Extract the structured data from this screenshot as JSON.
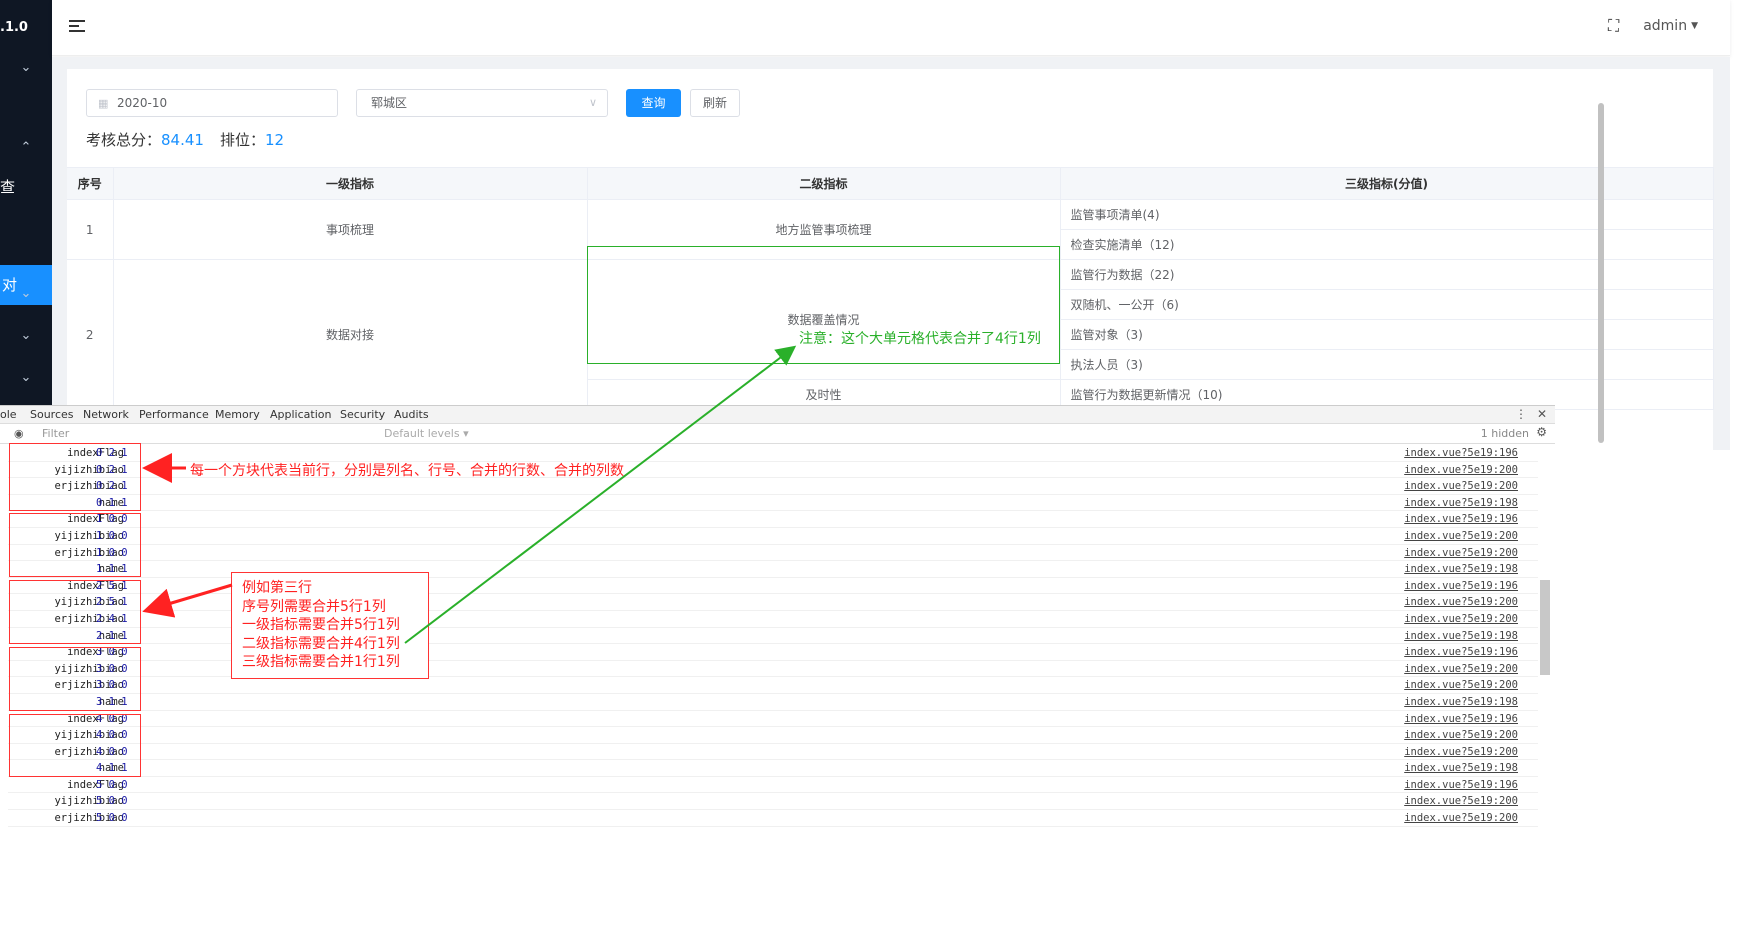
{
  "sidebar": {
    "version": ".1.0",
    "item_cha": "查",
    "item_active": "对"
  },
  "header": {
    "user": "admin"
  },
  "filters": {
    "date": "2020-10",
    "district": "郓城区",
    "query_label": "查询",
    "refresh_label": "刷新"
  },
  "score": {
    "total_label": "考核总分：",
    "total_value": "84.41",
    "rank_label": "排位：",
    "rank_value": "12"
  },
  "table": {
    "headers": [
      "序号",
      "一级指标",
      "二级指标",
      "三级指标(分值)"
    ],
    "row1": {
      "no": "1",
      "l1": "事项梳理",
      "l2": "地方监管事项梳理",
      "l3a": "监管事项清单(4)",
      "l3b": "检查实施清单（12)"
    },
    "row2": {
      "no": "2",
      "l1": "数据对接",
      "l2": "数据覆盖情况",
      "l3a": "监管行为数据（22)",
      "l3b": "双随机、一公开（6)",
      "l3c": "监管对象（3)",
      "l3d": "执法人员（3)",
      "l2b": "及时性",
      "l3e": "监管行为数据更新情况（10)"
    }
  },
  "annotations": {
    "green_note": "注意：这个大单元格代表合并了4行1列",
    "red_note": "每一个方块代表当前行，分别是列名、行号、合并的行数、合并的列数",
    "callout": [
      "例如第三行",
      "序号列需要合并5行1列",
      "一级指标需要合并5行1列",
      "二级指标需要合并4行1列",
      "三级指标需要合并1行1列"
    ]
  },
  "devtools": {
    "tabs": [
      "ole",
      "Sources",
      "Network",
      "Performance",
      "Memory",
      "Application",
      "Security",
      "Audits"
    ],
    "filter_placeholder": "Filter",
    "levels": "Default levels ▾",
    "hidden": "1 hidden"
  },
  "console_rows": [
    {
      "name": "indexFlag",
      "nums": "0 2 1",
      "src": "index.vue?5e19:196"
    },
    {
      "name": "yijizhibiao",
      "nums": "0 2 1",
      "src": "index.vue?5e19:200"
    },
    {
      "name": "erjizhibiao",
      "nums": "0 2 1",
      "src": "index.vue?5e19:200"
    },
    {
      "name": "name",
      "nums": "0 1 1",
      "src": "index.vue?5e19:198"
    },
    {
      "name": "indexFlag",
      "nums": "1 0 0",
      "src": "index.vue?5e19:196"
    },
    {
      "name": "yijizhibiao",
      "nums": "1 0 0",
      "src": "index.vue?5e19:200"
    },
    {
      "name": "erjizhibiao",
      "nums": "1 0 0",
      "src": "index.vue?5e19:200"
    },
    {
      "name": "name",
      "nums": "1 1 1",
      "src": "index.vue?5e19:198"
    },
    {
      "name": "indexFlag",
      "nums": "2 5 1",
      "src": "index.vue?5e19:196"
    },
    {
      "name": "yijizhibiao",
      "nums": "2 5 1",
      "src": "index.vue?5e19:200"
    },
    {
      "name": "erjizhibiao",
      "nums": "2 4 1",
      "src": "index.vue?5e19:200"
    },
    {
      "name": "name",
      "nums": "2 1 1",
      "src": "index.vue?5e19:198"
    },
    {
      "name": "indexFlag",
      "nums": "3 0 0",
      "src": "index.vue?5e19:196"
    },
    {
      "name": "yijizhibiao",
      "nums": "3 0 0",
      "src": "index.vue?5e19:200"
    },
    {
      "name": "erjizhibiao",
      "nums": "3 0 0",
      "src": "index.vue?5e19:200"
    },
    {
      "name": "name",
      "nums": "3 1 1",
      "src": "index.vue?5e19:198"
    },
    {
      "name": "indexFlag",
      "nums": "4 0 0",
      "src": "index.vue?5e19:196"
    },
    {
      "name": "yijizhibiao",
      "nums": "4 0 0",
      "src": "index.vue?5e19:200"
    },
    {
      "name": "erjizhibiao",
      "nums": "4 0 0",
      "src": "index.vue?5e19:200"
    },
    {
      "name": "name",
      "nums": "4 1 1",
      "src": "index.vue?5e19:198"
    },
    {
      "name": "indexFlag",
      "nums": "5 0 0",
      "src": "index.vue?5e19:196"
    },
    {
      "name": "yijizhibiao",
      "nums": "5 0 0",
      "src": "index.vue?5e19:200"
    },
    {
      "name": "erjizhibiao",
      "nums": "5 0 0",
      "src": "index.vue?5e19:200"
    }
  ],
  "colors": {
    "primary": "#1890ff",
    "annotation_green": "#2ab02a",
    "annotation_red": "#ff2222",
    "sidebar_bg": "#0f1724"
  }
}
